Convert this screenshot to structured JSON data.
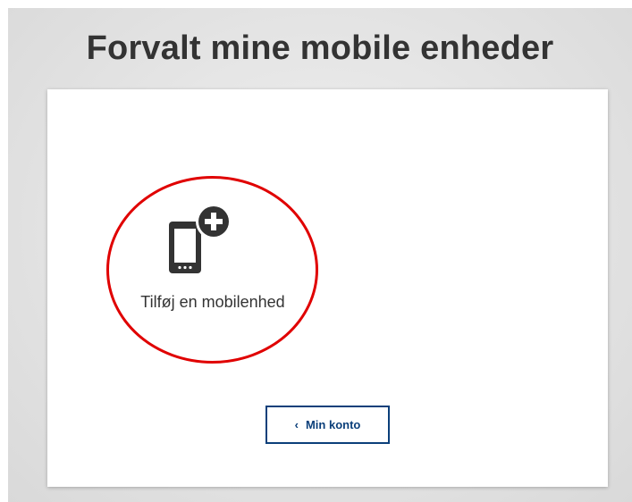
{
  "page": {
    "title": "Forvalt mine mobile enheder"
  },
  "add_device": {
    "label": "Tilføj en mobilenhed",
    "icon": "add-mobile-device-icon"
  },
  "account_button": {
    "chevron": "‹",
    "label": "Min konto"
  },
  "colors": {
    "title_text": "#333333",
    "button_border": "#0b3f7a",
    "highlight_ring": "#e00000",
    "icon_fill": "#333333"
  }
}
